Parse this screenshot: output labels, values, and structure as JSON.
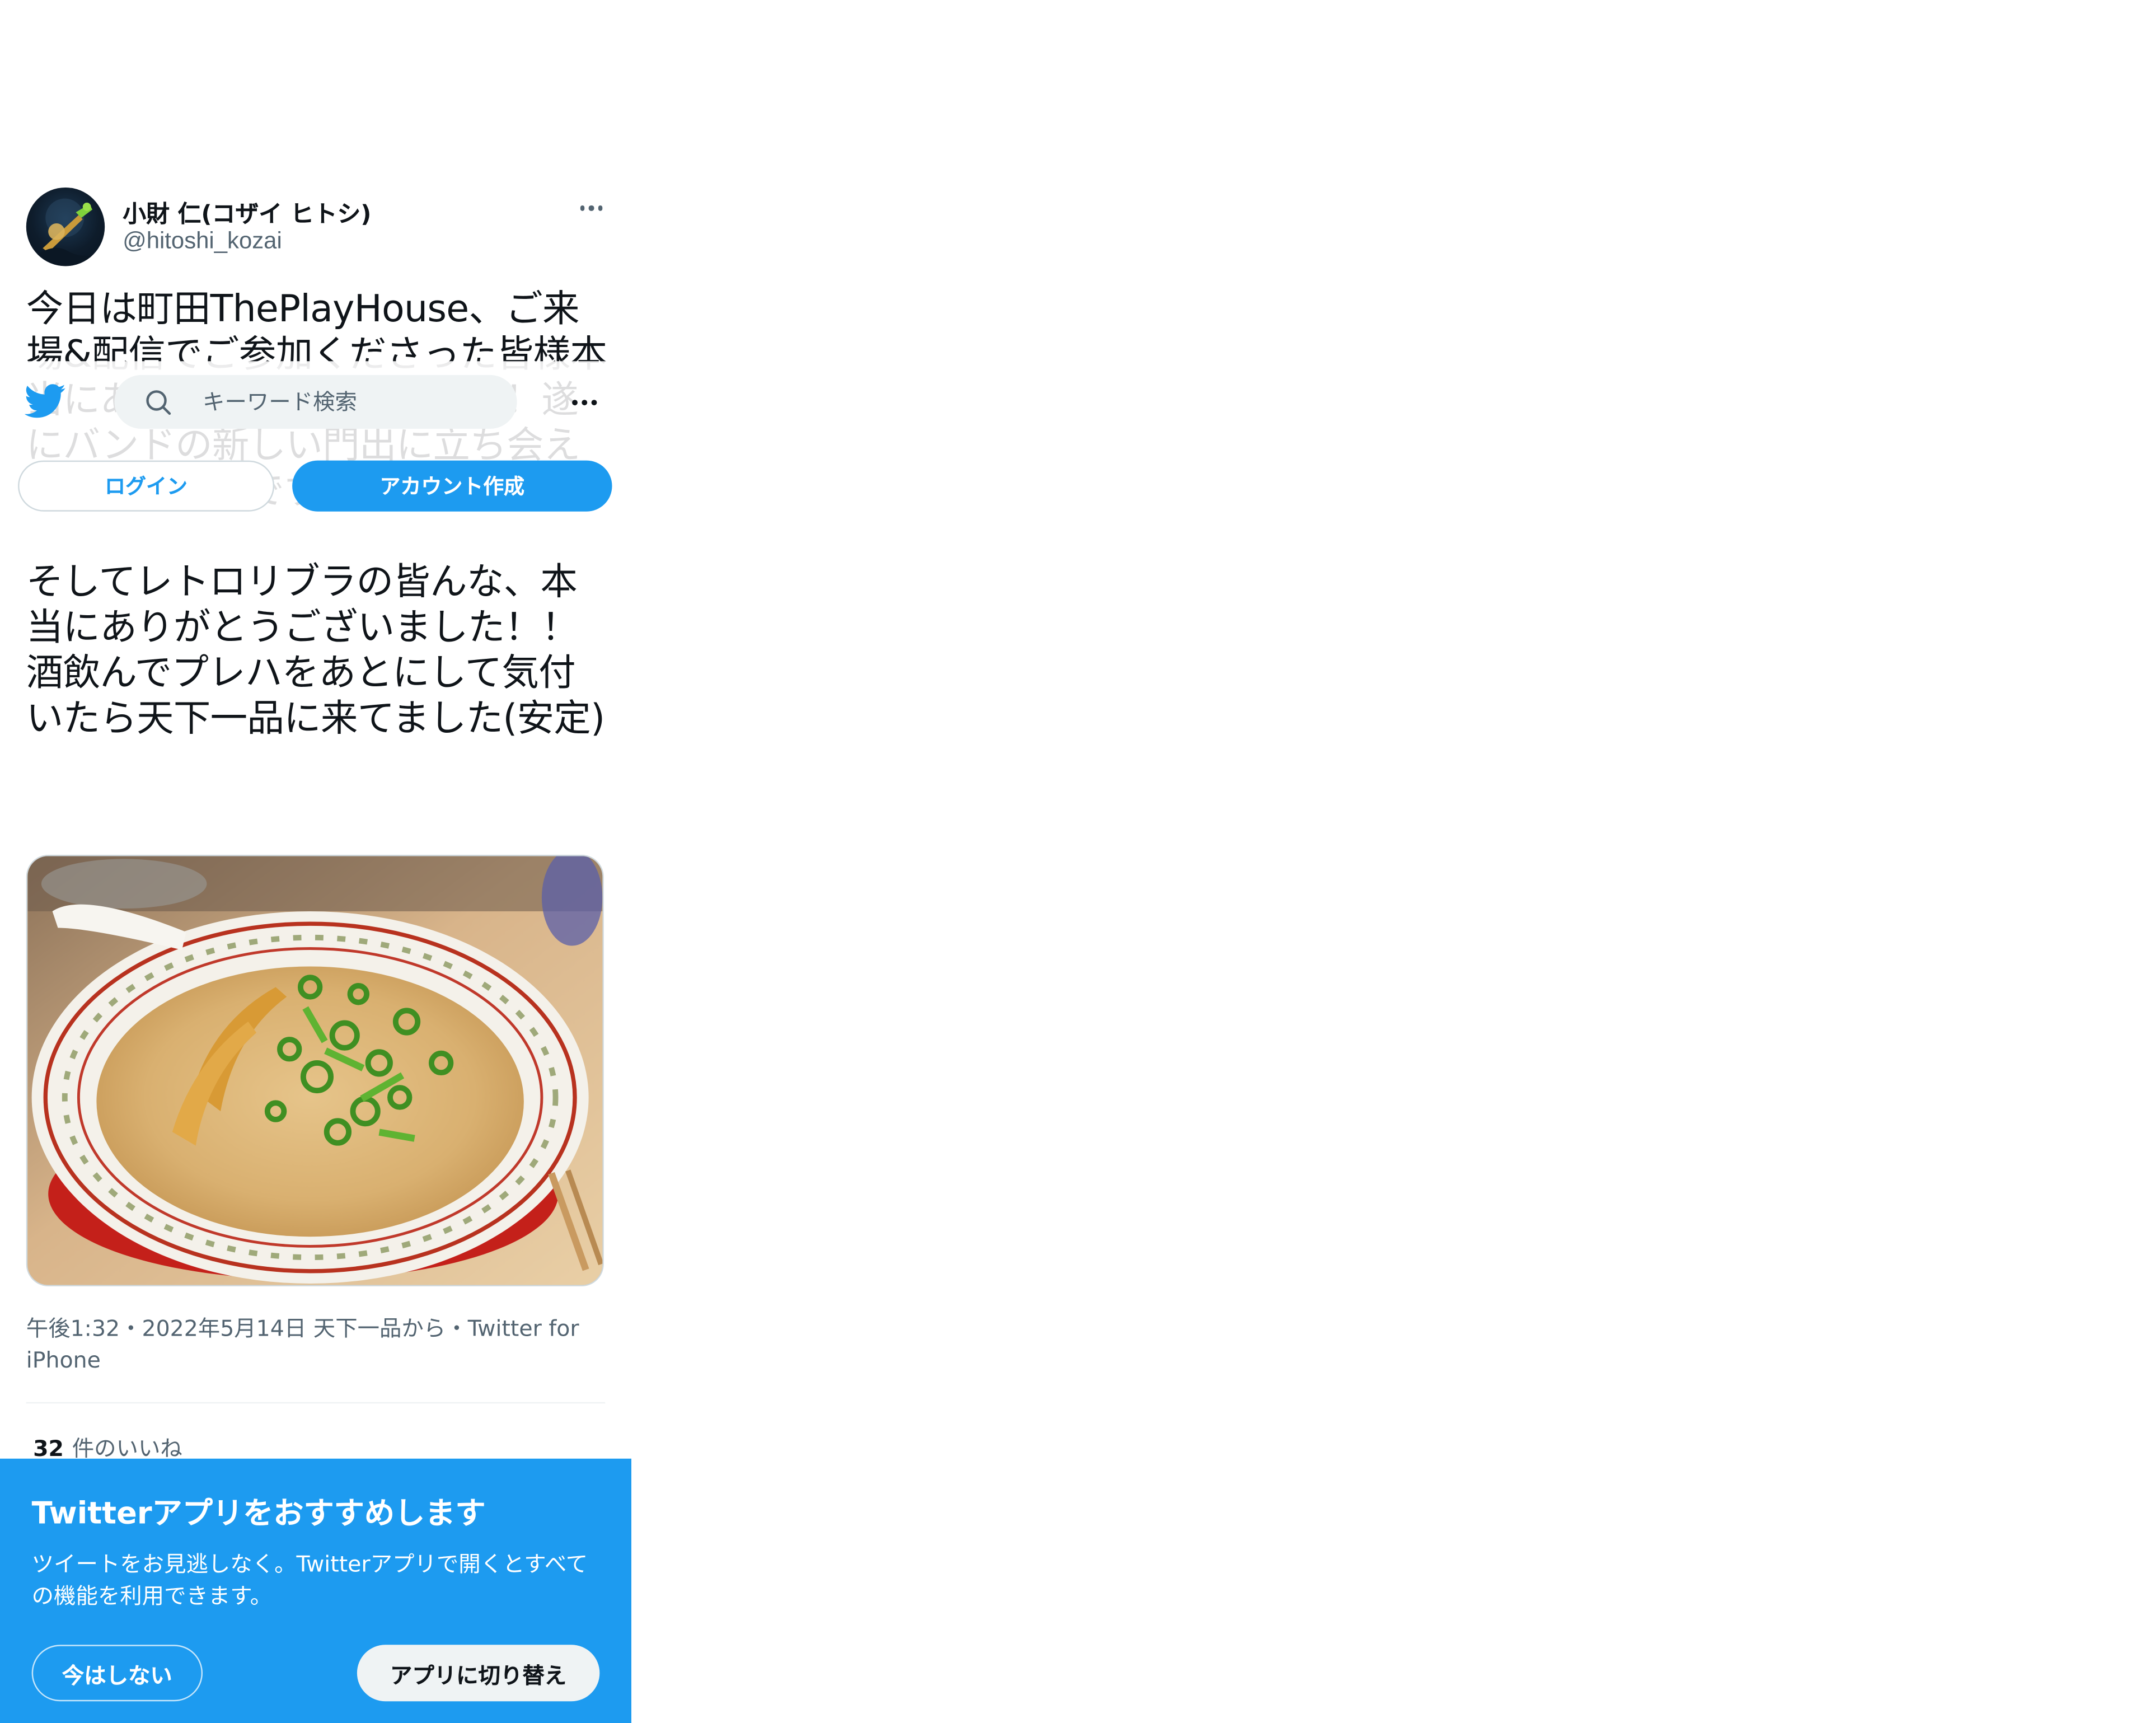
{
  "tweet": {
    "display_name": "小財 仁(コザイ ヒトシ)",
    "handle": "@hitoshi_kozai",
    "text": "今日は町田ThePlayHouse、ご来場&配信でご参加くださった皆様本当にありがとうございました！遂にバンドの新しい門出に立ち会えて嬉しかったです。\n\nそしてレトロリブラの皆んな、本当にありがとうございました！！\n酒飲んでプレハをあとにして気付いたら天下一品に来てました(安定)",
    "photo_icon": "ramen-photo",
    "timestamp": "午後1:32・2022年5月14日",
    "location": "天下一品から",
    "separator": "・",
    "source": "Twitter for iPhone",
    "likes_count": "32",
    "likes_label": "件のいいね"
  },
  "topbar": {
    "logo_icon": "twitter-bird-icon",
    "search_placeholder": "キーワード検索",
    "login_label": "ログイン",
    "signup_label": "アカウント作成"
  },
  "promo": {
    "title": "Twitterアプリをおすすめします",
    "body": "ツイートをお見逃しなく。Twitterアプリで開くとすべての機能を利用できます。",
    "not_now_label": "今はしない",
    "switch_label": "アプリに切り替え"
  },
  "colors": {
    "accent": "#1d9bf0",
    "text_primary": "#0f1419",
    "text_secondary": "#536471"
  }
}
